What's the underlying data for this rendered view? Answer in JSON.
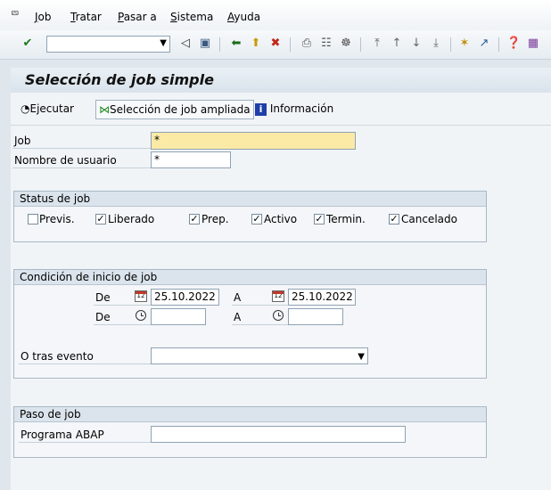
{
  "menu": {
    "items": [
      {
        "u": "J",
        "rest": "ob"
      },
      {
        "u": "T",
        "rest": "ratar"
      },
      {
        "u": "P",
        "rest": "asar a"
      },
      {
        "u": "S",
        "rest": "istema"
      },
      {
        "u": "A",
        "rest": "yuda"
      }
    ]
  },
  "toolbar": {
    "command_value": "",
    "icons": [
      "enter-icon",
      "save-icon",
      "back-icon",
      "exit-icon",
      "cancel-icon",
      "print-icon",
      "find-icon",
      "find-next-icon",
      "first-page-icon",
      "previous-page-icon",
      "next-page-icon",
      "last-page-icon",
      "create-session-icon",
      "shortcut-icon",
      "help-icon",
      "layout-icon"
    ]
  },
  "title": "Selección de job simple",
  "app_toolbar": {
    "execute": "Ejecutar",
    "extended": "Selección de job ampliada",
    "info": "Información"
  },
  "form": {
    "job_label": "Job",
    "job_value": "*",
    "user_label": "Nombre de usuario",
    "user_value": "*"
  },
  "status_group": {
    "title": "Status de job",
    "options": [
      {
        "label": "Previs.",
        "checked": false
      },
      {
        "label": "Liberado",
        "checked": true
      },
      {
        "label": "Prep.",
        "checked": true
      },
      {
        "label": "Activo",
        "checked": true
      },
      {
        "label": "Termin.",
        "checked": true
      },
      {
        "label": "Cancelado",
        "checked": true
      }
    ]
  },
  "start_group": {
    "title": "Condición de inicio de job",
    "from_label": "De",
    "to_label": "A",
    "from_date": "25.10.2022",
    "to_date": "25.10.2022",
    "from_time": "",
    "to_time": "",
    "event_label": "O tras evento",
    "event_value": ""
  },
  "step_group": {
    "title": "Paso de job",
    "program_label": "Programa ABAP",
    "program_value": ""
  },
  "colors": {
    "required_field": "#fbeaa6",
    "title_bg": "#d9e3ec",
    "group_header": "#dbe4ec"
  }
}
